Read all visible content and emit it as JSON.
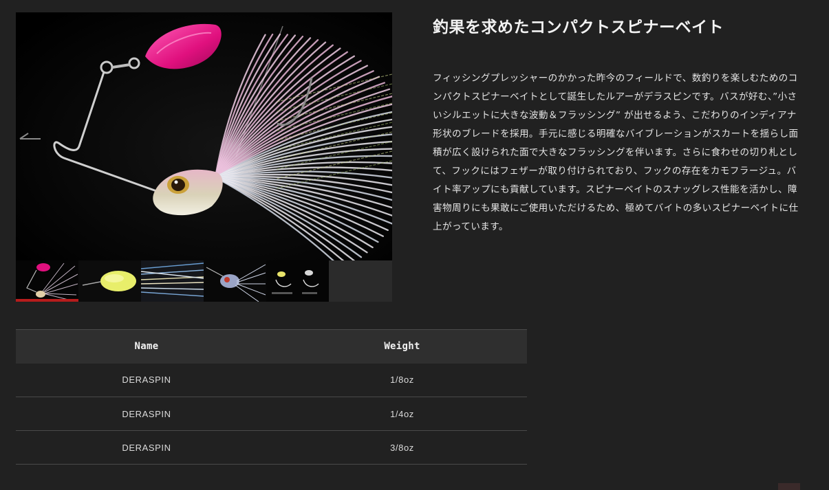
{
  "product": {
    "title": "釣果を求めたコンパクトスピナーベイト",
    "description": "フィッシングプレッシャーのかかった昨今のフィールドで、数釣りを楽しむためのコンパクトスピナーベイトとして誕生したルアーがデラスピンです。バスが好む、”小さいシルエットに大きな波動＆フラッシング” が出せるよう、こだわりのインディアナ形状のブレードを採用。手元に感じる明確なバイブレーションがスカートを揺らし面積が広く設けられた面で大きなフラッシングを伴います。さらに食わせの切り札として、フックにはフェザーが取り付けられており、フックの存在をカモフラージュ。バイト率アップにも貢献しています。スピナーベイトのスナッグレス性能を活かし、障害物周りにも果敢にご使用いただけるため、極めてバイトの多いスピナーベイトに仕上がっています。"
  },
  "gallery": {
    "prev_icon": "left-arrow-icon",
    "thumbnails": [
      {
        "name": "thumb-full-lure",
        "active": true
      },
      {
        "name": "thumb-blade-closeup",
        "active": false
      },
      {
        "name": "thumb-skirt-closeup",
        "active": false
      },
      {
        "name": "thumb-head-closeup",
        "active": false
      },
      {
        "name": "thumb-color-variants",
        "active": false
      }
    ]
  },
  "specs": {
    "headers": {
      "name": "Name",
      "weight": "Weight"
    },
    "rows": [
      {
        "name": "DERASPIN",
        "weight": "1/8oz"
      },
      {
        "name": "DERASPIN",
        "weight": "1/4oz"
      },
      {
        "name": "DERASPIN",
        "weight": "3/8oz"
      }
    ]
  },
  "colors": {
    "background": "#212121",
    "table_header": "#2f2f2f",
    "active_thumb_indicator": "#b71c1c",
    "blade_pink": "#e0107e"
  }
}
